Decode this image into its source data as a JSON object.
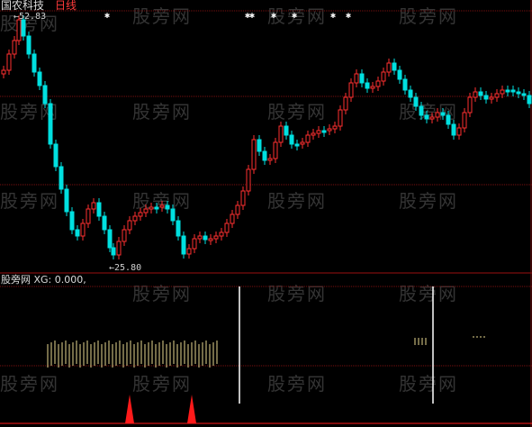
{
  "header": {
    "stock_name": "国农科技",
    "period_label": "日线"
  },
  "price_chart": {
    "high_marker": "←52.83",
    "low_marker": "←25.80",
    "colors": {
      "up": "#ff3030",
      "down": "#00e0e0",
      "grid": "#8b1a1a",
      "separator": "#9b1111"
    },
    "signal_star_glyph": "✱"
  },
  "indicator": {
    "title": "股旁网 XG: 0.000,",
    "colors": {
      "bars": "#e8d890",
      "line": "#ffffff",
      "signal": "#ff1a1a"
    }
  },
  "watermark": {
    "text": "股旁网"
  }
}
